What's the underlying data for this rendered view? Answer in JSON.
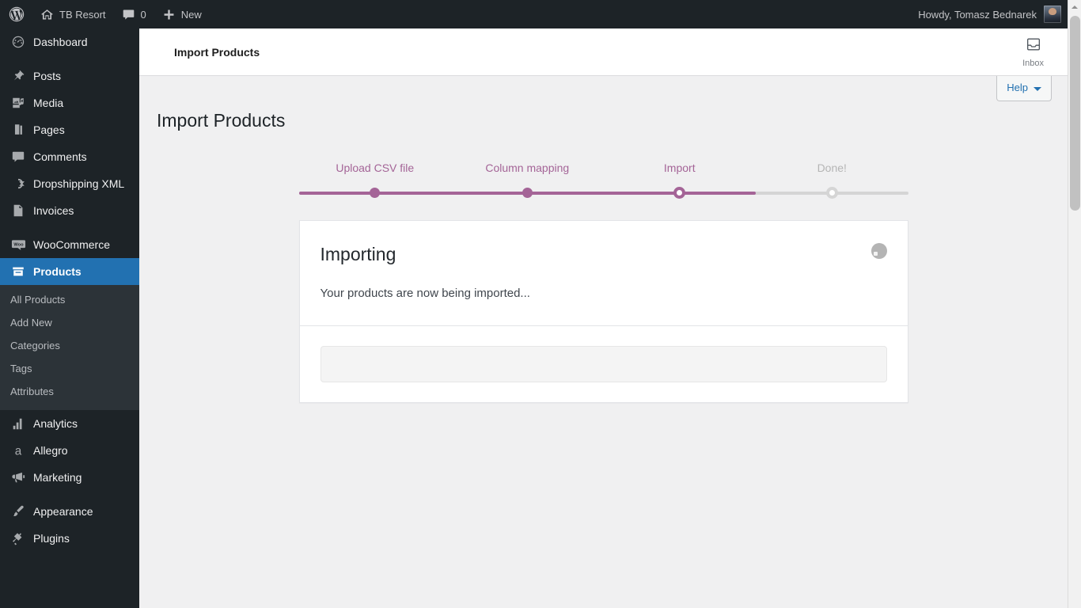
{
  "adminbar": {
    "wp_logo_name": "wordpress-logo-icon",
    "site_name": "TB Resort",
    "site_icon": "home-icon",
    "comments_icon": "comment-bubble-icon",
    "comments_count": "0",
    "new_icon": "plus-icon",
    "new_label": "New",
    "howdy": "Howdy, Tomasz Bednarek",
    "avatar_name": "user-avatar"
  },
  "sidebar": {
    "items": [
      {
        "label": "Dashboard",
        "icon": "dashboard-gauge-icon",
        "current": false
      },
      {
        "label": "Posts",
        "icon": "pushpin-icon",
        "current": false
      },
      {
        "label": "Media",
        "icon": "media-photo-music-icon",
        "current": false
      },
      {
        "label": "Pages",
        "icon": "pages-stack-icon",
        "current": false
      },
      {
        "label": "Comments",
        "icon": "comment-bubble-icon",
        "current": false
      },
      {
        "label": "Dropshipping XML",
        "icon": "sync-arrows-icon",
        "current": false
      },
      {
        "label": "Invoices",
        "icon": "invoice-document-icon",
        "current": false
      },
      {
        "label": "WooCommerce",
        "icon": "woocommerce-logo-icon",
        "current": false
      },
      {
        "label": "Products",
        "icon": "products-box-icon",
        "current": true
      },
      {
        "label": "Analytics",
        "icon": "bar-chart-icon",
        "current": false
      },
      {
        "label": "Allegro",
        "icon": "allegro-a-icon",
        "current": false
      },
      {
        "label": "Marketing",
        "icon": "megaphone-icon",
        "current": false
      },
      {
        "label": "Appearance",
        "icon": "paintbrush-icon",
        "current": false
      },
      {
        "label": "Plugins",
        "icon": "plug-icon",
        "current": false
      }
    ],
    "submenu": [
      {
        "label": "All Products"
      },
      {
        "label": "Add New"
      },
      {
        "label": "Categories"
      },
      {
        "label": "Tags"
      },
      {
        "label": "Attributes"
      }
    ]
  },
  "woo_header": {
    "title": "Import Products",
    "inbox_label": "Inbox",
    "inbox_icon": "inbox-tray-icon"
  },
  "screen_meta": {
    "help_label": "Help",
    "help_caret_icon": "chevron-down-icon"
  },
  "page": {
    "title": "Import Products"
  },
  "stepper": {
    "accent_color": "#a46497",
    "inactive_color": "#d5d5d5",
    "steps": [
      {
        "label": "Upload CSV file",
        "state": "complete"
      },
      {
        "label": "Column mapping",
        "state": "complete"
      },
      {
        "label": "Import",
        "state": "current"
      },
      {
        "label": "Done!",
        "state": "upcoming"
      }
    ]
  },
  "card": {
    "title": "Importing",
    "message": "Your products are now being imported...",
    "spinner_icon": "loading-spinner-icon",
    "progress_percent": 0
  },
  "scrollbar": {
    "up_arrow_icon": "scroll-up-arrow-icon"
  }
}
